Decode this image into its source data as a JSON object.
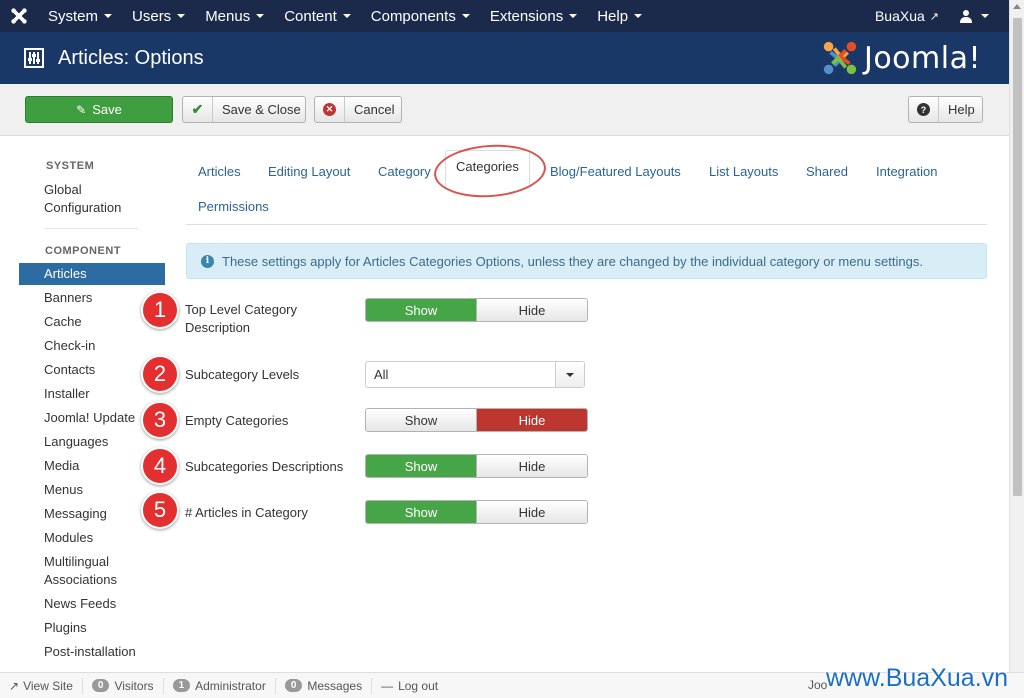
{
  "navbar": {
    "menus": [
      {
        "label": "System"
      },
      {
        "label": "Users"
      },
      {
        "label": "Menus"
      },
      {
        "label": "Content"
      },
      {
        "label": "Components"
      },
      {
        "label": "Extensions"
      },
      {
        "label": "Help"
      }
    ],
    "site_name": "BuaXua"
  },
  "header": {
    "title": "Articles: Options",
    "brand": "Joomla!"
  },
  "toolbar": {
    "save_label": "Save",
    "save_close_label": "Save & Close",
    "cancel_label": "Cancel",
    "help_label": "Help"
  },
  "sidebar": {
    "system_heading": "SYSTEM",
    "global_config_line1": "Global",
    "global_config_line2": "Configuration",
    "component_heading": "COMPONENT",
    "items": [
      {
        "label": "Articles",
        "active": true
      },
      {
        "label": "Banners"
      },
      {
        "label": "Cache"
      },
      {
        "label": "Check-in"
      },
      {
        "label": "Contacts"
      },
      {
        "label": "Installer"
      },
      {
        "label": "Joomla! Update"
      },
      {
        "label": "Languages"
      },
      {
        "label": "Media"
      },
      {
        "label": "Menus"
      },
      {
        "label": "Messaging"
      },
      {
        "label": "Modules"
      },
      {
        "label": "Multilingual"
      },
      {
        "label": "Associations"
      },
      {
        "label": "News Feeds"
      },
      {
        "label": "Plugins"
      },
      {
        "label": "Post-installation"
      }
    ]
  },
  "tabs": [
    {
      "label": "Articles"
    },
    {
      "label": "Editing Layout"
    },
    {
      "label": "Category"
    },
    {
      "label": "Categories",
      "active": true
    },
    {
      "label": "Blog/Featured Layouts"
    },
    {
      "label": "List Layouts"
    },
    {
      "label": "Shared"
    },
    {
      "label": "Integration"
    },
    {
      "label": "Permissions"
    }
  ],
  "alert": {
    "text": "These settings apply for Articles Categories Options, unless they are changed by the individual category or menu settings."
  },
  "fields": [
    {
      "number": "1",
      "label_line1": "Top Level Category",
      "label_line2": "Description",
      "show": "Show",
      "hide": "Hide",
      "selected": "show"
    },
    {
      "number": "2",
      "label": "Subcategory Levels",
      "select_value": "All"
    },
    {
      "number": "3",
      "label": "Empty Categories",
      "show": "Show",
      "hide": "Hide",
      "selected": "hide"
    },
    {
      "number": "4",
      "label": "Subcategories Descriptions",
      "show": "Show",
      "hide": "Hide",
      "selected": "show"
    },
    {
      "number": "5",
      "label": "# Articles in Category",
      "show": "Show",
      "hide": "Hide",
      "selected": "show"
    }
  ],
  "statusbar": {
    "view_site": "View Site",
    "visitors_count": "0",
    "visitors_label": "Visitors",
    "admin_count": "1",
    "admin_label": "Administrator",
    "messages_count": "0",
    "messages_label": "Messages",
    "logout": "Log out",
    "right_text": "Joo"
  },
  "watermark": "www.BuaXua.vn",
  "colors": {
    "navbar": "#1b2a4a",
    "header": "#1a3867",
    "save_green": "#3f9e3f",
    "toggle_green": "#46a546",
    "toggle_red": "#bd362f",
    "active_sidebar": "#2d6ca2",
    "annotation_red": "#e32f2f"
  }
}
